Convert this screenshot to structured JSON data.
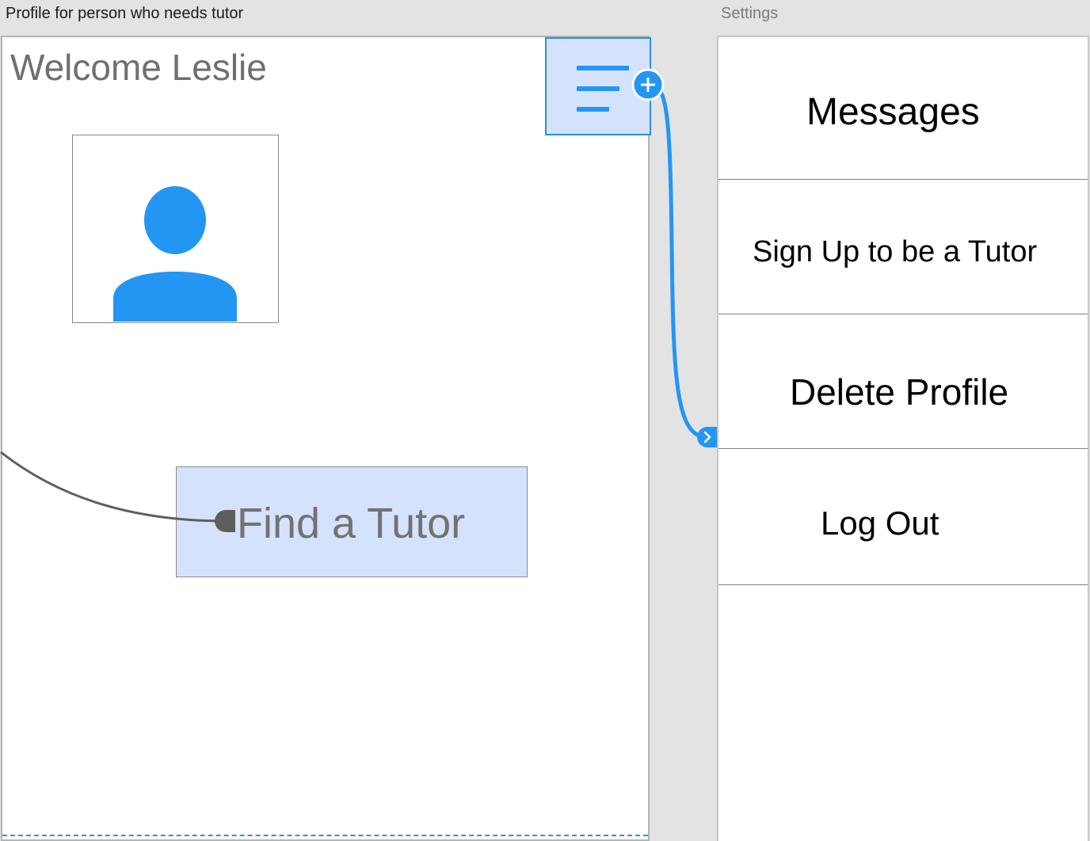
{
  "artboards": {
    "profile": {
      "title": "Profile for person who needs tutor",
      "welcome": "Welcome Leslie",
      "menu_icon": "hamburger-menu-icon",
      "avatar_icon": "person-icon",
      "find_tutor_label": "Find a Tutor"
    },
    "settings": {
      "title": "Settings",
      "items": [
        {
          "label": "Messages"
        },
        {
          "label": "Sign Up to be a Tutor"
        },
        {
          "label": "Delete Profile"
        },
        {
          "label": "Log Out"
        }
      ]
    }
  },
  "connectors": {
    "menu_to_settings": {
      "color": "#2396f3",
      "start_icon": "plus-icon",
      "end_icon": "chevron-right-icon"
    },
    "incoming_to_find_tutor": {
      "color": "#5e5e5e"
    }
  },
  "colors": {
    "accent": "#2396f3",
    "selection_fill": "#d5e2fb",
    "canvas": "#e3e3e3"
  }
}
